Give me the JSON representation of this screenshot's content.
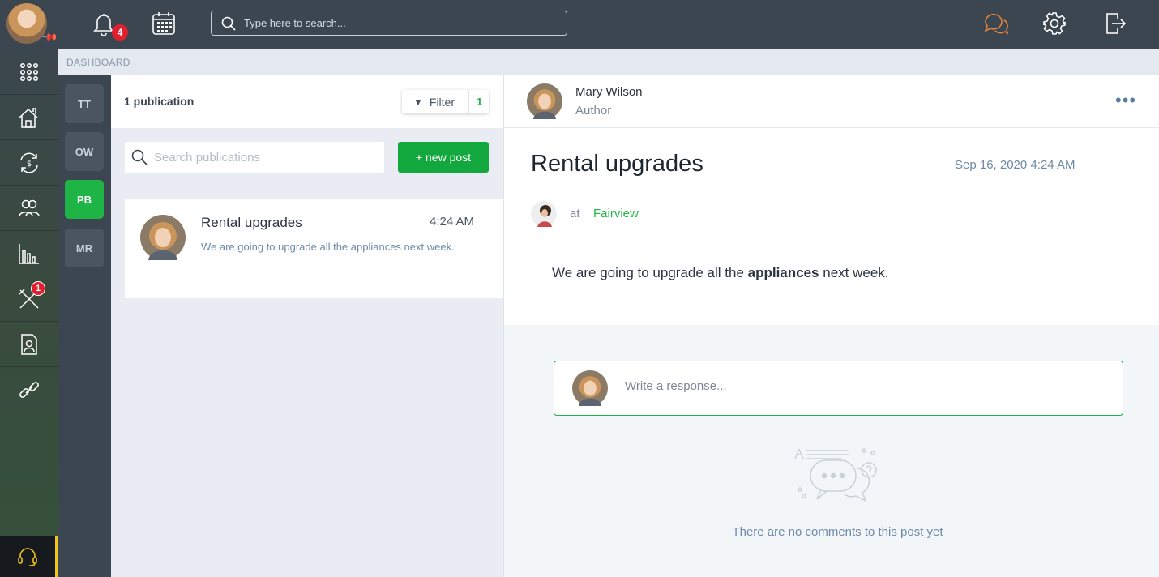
{
  "topbar": {
    "notification_count": "4",
    "search_placeholder": "Type here to search..."
  },
  "rail": {
    "items": [
      {
        "icon": "apps-grid-icon"
      },
      {
        "icon": "buildings-icon"
      },
      {
        "icon": "money-cycle-icon"
      },
      {
        "icon": "contacts-icon"
      },
      {
        "icon": "reports-chart-icon"
      },
      {
        "icon": "maintenance-tools-icon",
        "badge": "1"
      },
      {
        "icon": "tenant-file-icon"
      },
      {
        "icon": "link-icon"
      }
    ]
  },
  "breadcrumb": "DASHBOARD",
  "communities": [
    {
      "label": "TT"
    },
    {
      "label": "OW"
    },
    {
      "label": "PB",
      "active": true
    },
    {
      "label": "MR"
    }
  ],
  "publications": {
    "count_label": "1 publication",
    "filter_label": "Filter",
    "filter_count": "1",
    "search_placeholder": "Search publications",
    "new_post_label": "+ new post",
    "items": [
      {
        "title": "Rental upgrades",
        "time": "4:24 AM",
        "excerpt": "We are going to upgrade all the appliances next week."
      }
    ]
  },
  "post": {
    "author_name": "Mary Wilson",
    "author_role": "Author",
    "title": "Rental upgrades",
    "date": "Sep 16, 2020 4:24 AM",
    "at_label": "at",
    "location": "Fairview",
    "body_before": "We are going to upgrade all the ",
    "body_bold": "appliances",
    "body_after": " next week.",
    "response_placeholder": "Write a response...",
    "empty_comments": "There are no comments to this post yet"
  },
  "colors": {
    "accent_green": "#1eb546",
    "badge_red": "#e0202f",
    "chat_orange": "#e8833a",
    "support_yellow": "#f0c419"
  }
}
